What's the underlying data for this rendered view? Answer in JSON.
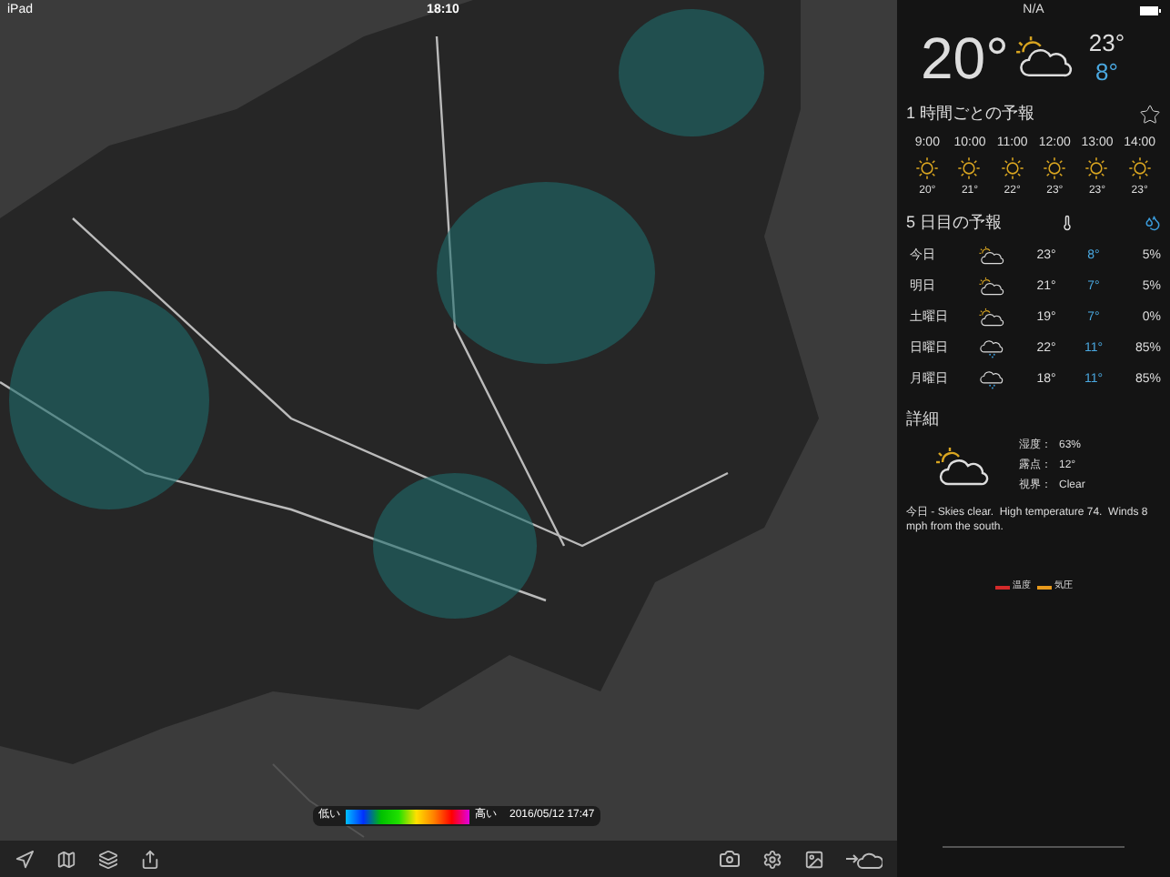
{
  "status_bar": {
    "device": "iPad",
    "time": "18:10",
    "location": "N/A"
  },
  "legend": {
    "low": "低い",
    "high": "高い",
    "timestamp": "2016/05/12 17:47"
  },
  "current": {
    "temp": "20°",
    "kind": "cloud_sun",
    "high": "23°",
    "low": "8°"
  },
  "hourly": {
    "title": "1 時間ごとの予報",
    "items": [
      {
        "time": "9:00",
        "kind": "sun",
        "temp": "20°"
      },
      {
        "time": "10:00",
        "kind": "sun",
        "temp": "21°"
      },
      {
        "time": "11:00",
        "kind": "sun",
        "temp": "22°"
      },
      {
        "time": "12:00",
        "kind": "sun",
        "temp": "23°"
      },
      {
        "time": "13:00",
        "kind": "sun",
        "temp": "23°"
      },
      {
        "time": "14:00",
        "kind": "sun",
        "temp": "23°"
      }
    ]
  },
  "daily": {
    "title": "5 日目の予報",
    "rows": [
      {
        "day": "今日",
        "kind": "cloud_sun",
        "high": "23°",
        "low": "8°",
        "precip": "5%"
      },
      {
        "day": "明日",
        "kind": "cloud_sun",
        "high": "21°",
        "low": "7°",
        "precip": "5%"
      },
      {
        "day": "土曜日",
        "kind": "cloud_sun",
        "high": "19°",
        "low": "7°",
        "precip": "0%"
      },
      {
        "day": "日曜日",
        "kind": "rain",
        "high": "22°",
        "low": "11°",
        "precip": "85%"
      },
      {
        "day": "月曜日",
        "kind": "rain",
        "high": "18°",
        "low": "11°",
        "precip": "85%"
      }
    ]
  },
  "details": {
    "title": "詳細",
    "kind": "cloud_sun",
    "items": [
      {
        "label": "湿度：",
        "value": "63%"
      },
      {
        "label": "露点：",
        "value": "12°"
      },
      {
        "label": "視界：",
        "value": "Clear"
      }
    ],
    "summary": "今日 - Skies clear.  High temperature 74.  Winds 8 mph from the south.",
    "chart_legend": [
      {
        "label": "温度",
        "color": "#d42a2a"
      },
      {
        "label": "気圧",
        "color": "#e89a1c"
      }
    ]
  }
}
